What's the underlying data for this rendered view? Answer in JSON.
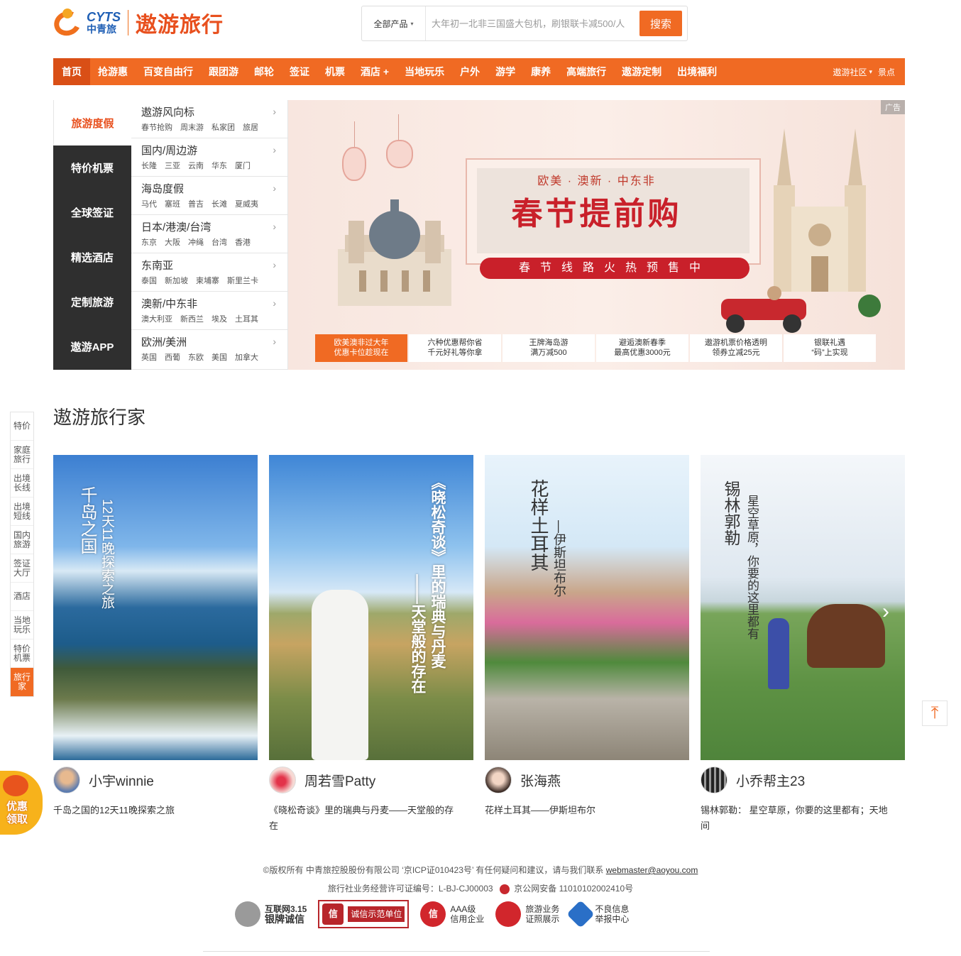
{
  "header": {
    "logo_en": "CYTS",
    "logo_cn": "中青旅",
    "site_name": "遨游旅行",
    "search": {
      "category": "全部产品",
      "placeholder": "大年初一北非三国盛大包机，刷银联卡减500/人",
      "button": "搜索"
    }
  },
  "nav": {
    "items": [
      "首页",
      "抢游惠",
      "百变自由行",
      "跟团游",
      "邮轮",
      "签证",
      "机票",
      "酒店 +",
      "当地玩乐",
      "户外",
      "游学",
      "康养",
      "高端旅行",
      "遨游定制",
      "出境福利"
    ],
    "community": "遨游社区",
    "spots": "景点"
  },
  "menu": {
    "categories": [
      "旅游度假",
      "特价机票",
      "全球签证",
      "精选酒店",
      "定制旅游",
      "遨游APP"
    ],
    "groups": [
      {
        "title": "遨游风向标",
        "links": [
          "春节抢购",
          "周末游",
          "私家团",
          "旅居"
        ]
      },
      {
        "title": "国内/周边游",
        "links": [
          "长隆",
          "三亚",
          "云南",
          "华东",
          "厦门"
        ]
      },
      {
        "title": "海岛度假",
        "links": [
          "马代",
          "塞班",
          "普吉",
          "长滩",
          "夏威夷"
        ]
      },
      {
        "title": "日本/港澳/台湾",
        "links": [
          "东京",
          "大阪",
          "冲绳",
          "台湾",
          "香港"
        ]
      },
      {
        "title": "东南亚",
        "links": [
          "泰国",
          "新加坡",
          "柬埔寨",
          "斯里兰卡"
        ]
      },
      {
        "title": "澳新/中东非",
        "links": [
          "澳大利亚",
          "新西兰",
          "埃及",
          "土耳其"
        ]
      },
      {
        "title": "欧洲/美洲",
        "links": [
          "英国",
          "西葡",
          "东欧",
          "美国",
          "加拿大"
        ]
      }
    ],
    "arrow": "›"
  },
  "banner": {
    "ad_tag": "广告",
    "subtitle": "欧美 · 澳新 · 中东非",
    "title": "春节提前购",
    "ribbon": "春节线路火热预售中",
    "tabs": [
      {
        "l1": "欧美澳非过大年",
        "l2": "优惠卡位趁现在"
      },
      {
        "l1": "六种优惠帮你省",
        "l2": "千元好礼等你拿"
      },
      {
        "l1": "王牌海岛游",
        "l2": "满万减500"
      },
      {
        "l1": "避逅澳新春季",
        "l2": "最高优惠3000元"
      },
      {
        "l1": "遨游机票价格透明",
        "l2": "领券立减25元"
      },
      {
        "l1": "银联礼遇",
        "l2": "“码”上实现"
      }
    ]
  },
  "section": {
    "title": "遨游旅行家",
    "next": "›",
    "cards": [
      {
        "user": "小宇winnie",
        "desc": "千岛之国的12天11晚探索之旅",
        "v1": "千岛之国",
        "v2": "12天11晚探索之旅"
      },
      {
        "user": "周若雪Patty",
        "desc": "《晓松奇谈》里的瑞典与丹麦——天堂般的存在",
        "v1": "《晓松奇谈》里的瑞典与丹麦",
        "v2": "——天堂般的存在"
      },
      {
        "user": "张海燕",
        "desc": "花样土耳其——伊斯坦布尔",
        "v1": "花样土耳其",
        "v2": "—伊斯坦布尔"
      },
      {
        "user": "小乔帮主23",
        "desc": "锡林郭勒： 星空草原，你要的这里都有；天地间",
        "v1": "锡林郭勒",
        "v2": "星空草原，你要的这里都有"
      }
    ]
  },
  "float": {
    "items": [
      "特价",
      "家庭旅行",
      "出境长线",
      "出境短线",
      "国内旅游",
      "签证大厅",
      "酒店",
      "当地玩乐",
      "特价机票",
      "旅行家"
    ],
    "promo": "优惠领取",
    "totop": "⤒"
  },
  "footer": {
    "line1": "©版权所有 中青旅控股股份有限公司 ‘京ICP证010423号’   有任何疑问和建议，请与我们联系 ",
    "email": "webmaster@aoyou.com",
    "line2": "旅行社业务经营许可证编号：L-BJ-CJ00003",
    "line2b": "京公网安备 11010102002410号",
    "badges": [
      {
        "t1": "互联网3.15",
        "t2": "银牌诚信"
      },
      {
        "t1": "诚信示范单位",
        "t2": ""
      },
      {
        "t1": "AAA级",
        "t2": "信用企业"
      },
      {
        "t1": "旅游业务",
        "t2": "证照展示"
      },
      {
        "t1": "不良信息",
        "t2": "举报中心"
      }
    ]
  },
  "colors": {
    "accent": "#f06a23",
    "dark_menu": "#2f2f2f",
    "brand_red": "#e8501e"
  }
}
